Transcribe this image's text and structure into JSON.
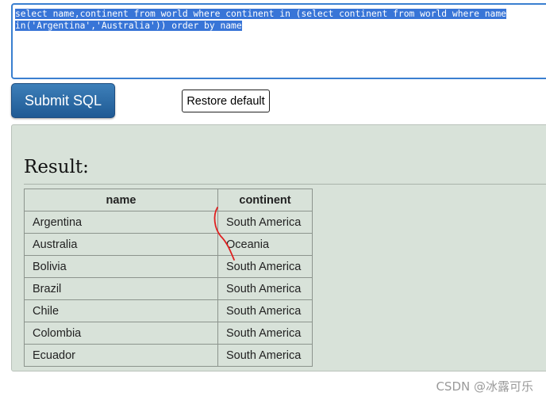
{
  "editor": {
    "sql_line1": "select name,continent from world where continent in (select continent from world where name",
    "sql_line2": "in('Argentina','Australia')) order by name"
  },
  "buttons": {
    "submit_label": "Submit SQL",
    "restore_label": "Restore default"
  },
  "result": {
    "title": "Result:",
    "columns": [
      "name",
      "continent"
    ],
    "rows": [
      [
        "Argentina",
        "South America"
      ],
      [
        "Australia",
        "Oceania"
      ],
      [
        "Bolivia",
        "South America"
      ],
      [
        "Brazil",
        "South America"
      ],
      [
        "Chile",
        "South America"
      ],
      [
        "Colombia",
        "South America"
      ],
      [
        "Ecuador",
        "South America"
      ]
    ]
  },
  "watermark": "CSDN @冰露可乐",
  "colors": {
    "selection": "#3875d7",
    "submit_bg": "#2d6ea8",
    "panel_bg": "#d8e2d9",
    "annotation": "#e02020"
  }
}
